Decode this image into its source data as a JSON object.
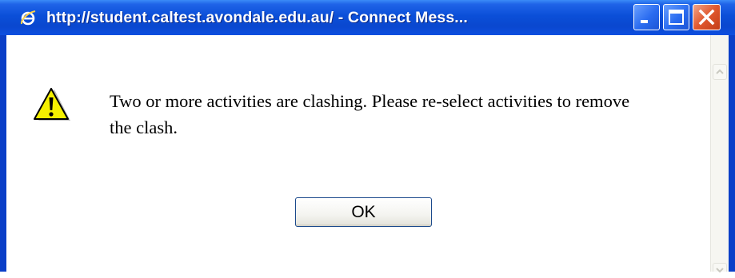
{
  "window": {
    "title": "http://student.caltest.avondale.edu.au/ - Connect Mess..."
  },
  "dialog": {
    "message": "Two or more activities are clashing. Please re-select activities to remove the clash.",
    "ok_label": "OK",
    "icon": "warning-icon"
  },
  "titlebar_icons": [
    "ie-icon",
    "minimize-icon",
    "maximize-icon",
    "close-icon"
  ],
  "colors": {
    "titlebar": "#0b4fd8",
    "close_button": "#e0582e",
    "warning_fill": "#f5f000",
    "client_bg": "#ffffff"
  }
}
